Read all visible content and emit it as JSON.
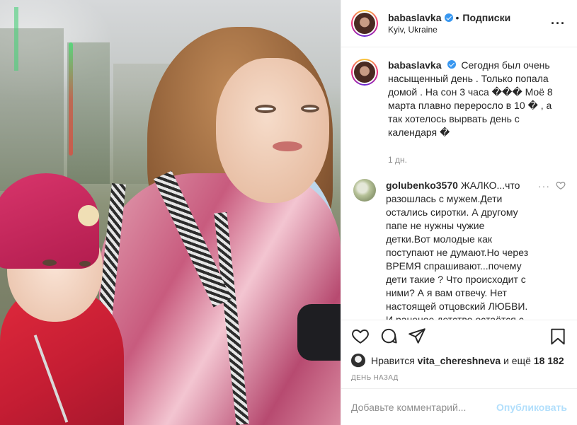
{
  "post": {
    "author": {
      "username": "babaslavka",
      "verified": true,
      "follow_text": "Подписки",
      "location": "Kyiv, Ukraine"
    },
    "more_icon": "more-horizontal-icon",
    "caption": {
      "username": "babaslavka",
      "text": "Сегодня был очень насыщенный день . Только попала домой . На сон 3 часа ��� Моё 8 марта плавно переросло в 10 � , а так хотелось вырвать день с календаря �",
      "time": "1 дн."
    },
    "comments": [
      {
        "username": "golubenko3570",
        "text": "ЖАЛКО...что разошлась с мужем.Дети остались сиротки. А другому папе не нужны чужие детки.Вот молодые как поступают не думают.Но через ВРЕМЯ спрашивают...почему дети такие ? Что происходит с ними? А я вам отвечу. Нет настоящей отцовский ЛЮБВИ. И раненое детство остаётся с ними всю жизнь."
      }
    ],
    "actions": {
      "like_icon": "heart-icon",
      "comment_icon": "comment-icon",
      "share_icon": "share-icon",
      "save_icon": "bookmark-icon"
    },
    "likes": {
      "prefix": "Нравится",
      "user": "vita_chereshneva",
      "connector": "и ещё",
      "count": "18 182"
    },
    "date": "ДЕНЬ НАЗАД",
    "add_comment": {
      "placeholder": "Добавьте комментарий...",
      "post_label": "Опубликовать"
    }
  },
  "colors": {
    "text": "#262626",
    "muted": "#8e8e8e",
    "verified": "#3897f0",
    "post_button_disabled": "#b2dffc",
    "border": "#efefef"
  }
}
